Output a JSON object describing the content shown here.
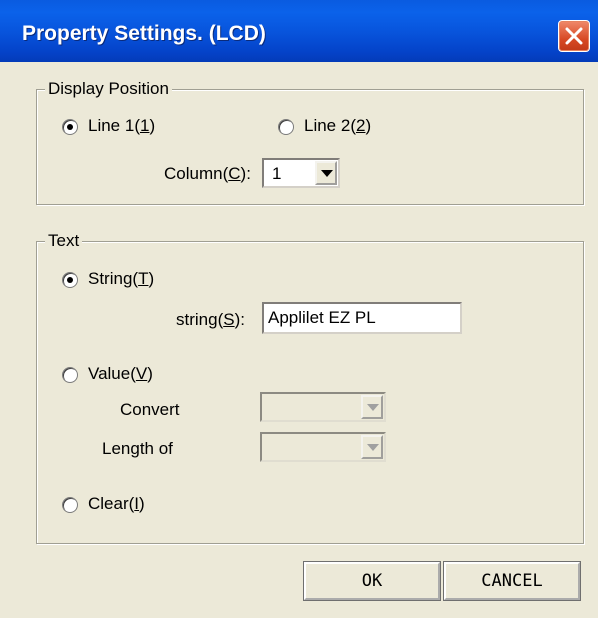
{
  "window": {
    "title": "Property Settings. (LCD)",
    "close_icon": "close-icon"
  },
  "display_position": {
    "legend": "Display Position",
    "line1_label_pre": "Line 1(",
    "line1_key": "1",
    "line1_label_post": ")",
    "line1_selected": true,
    "line2_label_pre": "Line 2(",
    "line2_key": "2",
    "line2_label_post": ")",
    "line2_selected": false,
    "column_label_pre": "Column(",
    "column_key": "C",
    "column_label_post": "):",
    "column_value": "1"
  },
  "text_group": {
    "legend": "Text",
    "string_option_pre": "String(",
    "string_option_key": "T",
    "string_option_post": ")",
    "string_selected": true,
    "string_field_label_pre": "string(",
    "string_field_label_key": "S",
    "string_field_label_post": "):",
    "string_value": "Applilet EZ PL",
    "value_option_pre": "Value(",
    "value_option_key": "V",
    "value_option_post": ")",
    "value_selected": false,
    "convert_label": "Convert",
    "convert_value": "",
    "length_label": "Length of",
    "length_value": "",
    "clear_option_pre": "Clear(",
    "clear_option_key": "I",
    "clear_option_post": ")",
    "clear_selected": false
  },
  "buttons": {
    "ok": "OK",
    "cancel": "CANCEL"
  }
}
